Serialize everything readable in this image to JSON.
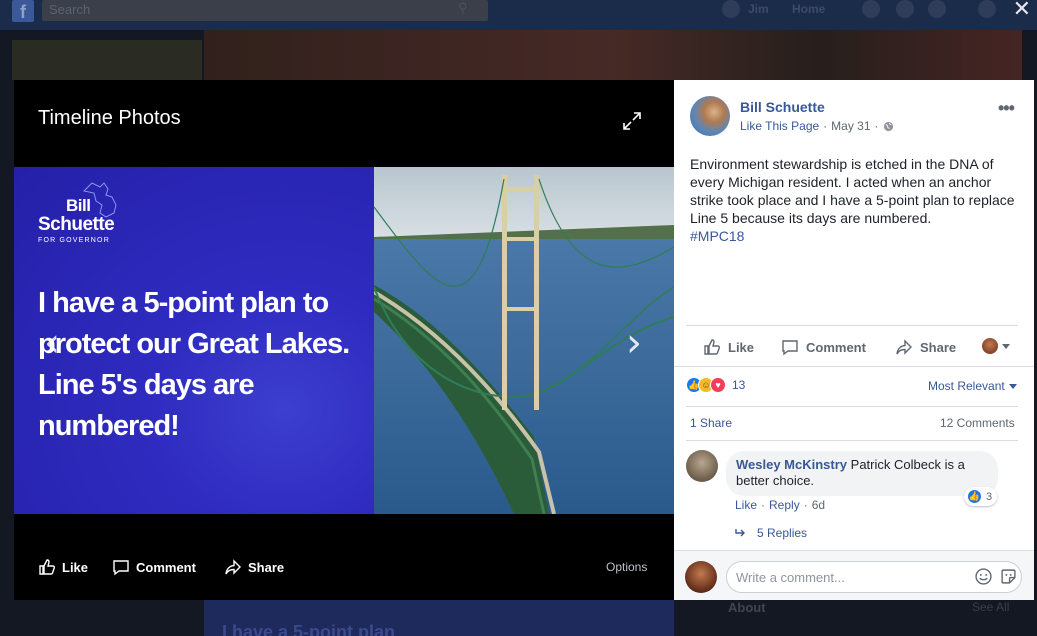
{
  "background": {
    "search_placeholder": "Search",
    "nav_user": "Jim",
    "nav_home": "Home",
    "about_heading": "About",
    "see_all": "See All",
    "bottom_teaser": "I have a 5-point plan"
  },
  "viewer": {
    "title": "Timeline Photos",
    "photo": {
      "logo_first": "Bill",
      "logo_last": "Schuette",
      "logo_sub": "FOR GOVERNOR",
      "headline": "I have a 5-point plan to protect our Great Lakes. Line 5's days are numbered!"
    },
    "actions": {
      "like": "Like",
      "comment": "Comment",
      "share": "Share",
      "options": "Options"
    }
  },
  "post": {
    "page_name": "Bill Schuette",
    "like_page": "Like This Page",
    "separator": "·",
    "date": "May 31",
    "text": "Environment stewardship is etched in the DNA of every Michigan resident. I acted when an anchor strike took place and I have a 5-point plan to replace Line 5 because its days are numbered.",
    "hashtag": "#MPC18",
    "actions": {
      "like": "Like",
      "comment": "Comment",
      "share": "Share"
    },
    "reaction_count": "13",
    "sort_label": "Most Relevant",
    "shares": "1 Share",
    "comments_count": "12 Comments"
  },
  "comment": {
    "author": "Wesley McKinstry",
    "text": "Patrick Colbeck is a better choice.",
    "reaction_count": "3",
    "like": "Like",
    "reply": "Reply",
    "age": "6d",
    "dot": "·",
    "replies": "5 Replies"
  },
  "composer": {
    "placeholder": "Write a comment..."
  },
  "colors": {
    "link": "#385898",
    "photo_blue": "#2a27b8",
    "like_blue": "#1877f2"
  }
}
